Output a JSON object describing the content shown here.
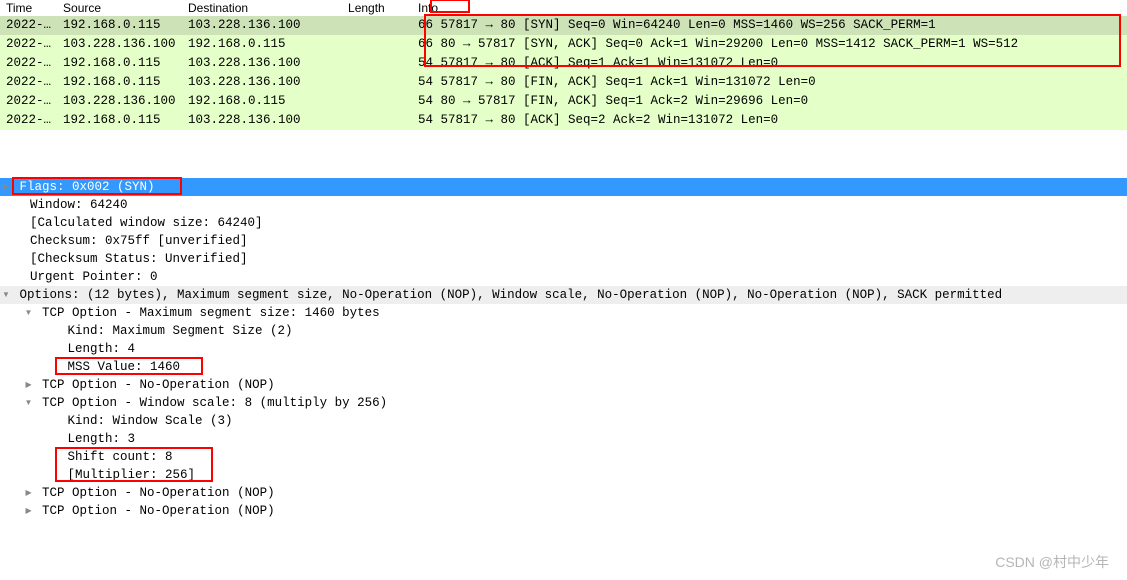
{
  "columns": {
    "time": "Time",
    "source": "Source",
    "destination": "Destination",
    "length": "Length",
    "info": "Info"
  },
  "packets": [
    {
      "time": "2022-…",
      "src": "192.168.0.115",
      "dst": "103.228.136.100",
      "len": "",
      "info": "66 57817 → 80 [SYN] Seq=0 Win=64240 Len=0 MSS=1460 WS=256 SACK_PERM=1",
      "cls": "row-sel"
    },
    {
      "time": "2022-…",
      "src": "103.228.136.100",
      "dst": "192.168.0.115",
      "len": "",
      "info": "66 80 → 57817 [SYN, ACK] Seq=0 Ack=1 Win=29200 Len=0 MSS=1412 SACK_PERM=1 WS=512",
      "cls": "row-light"
    },
    {
      "time": "2022-…",
      "src": "192.168.0.115",
      "dst": "103.228.136.100",
      "len": "",
      "info": "54 57817 → 80 [ACK] Seq=1 Ack=1 Win=131072 Len=0",
      "cls": "row-light"
    },
    {
      "time": "2022-…",
      "src": "192.168.0.115",
      "dst": "103.228.136.100",
      "len": "",
      "info": "54 57817 → 80 [FIN, ACK] Seq=1 Ack=1 Win=131072 Len=0",
      "cls": "row-light"
    },
    {
      "time": "2022-…",
      "src": "103.228.136.100",
      "dst": "192.168.0.115",
      "len": "",
      "info": "54 80 → 57817 [FIN, ACK] Seq=1 Ack=2 Win=29696 Len=0",
      "cls": "row-light"
    },
    {
      "time": "2022-…",
      "src": "192.168.0.115",
      "dst": "103.228.136.100",
      "len": "",
      "info": "54 57817 → 80 [ACK] Seq=2 Ack=2 Win=131072 Len=0",
      "cls": "row-light"
    }
  ],
  "detail": {
    "flags": "Flags: 0x002 (SYN)",
    "window": "Window: 64240",
    "calcwin": "[Calculated window size: 64240]",
    "checksum": "Checksum: 0x75ff [unverified]",
    "checksum_status": "[Checksum Status: Unverified]",
    "urgent": "Urgent Pointer: 0",
    "options_header": "Options: (12 bytes), Maximum segment size, No-Operation (NOP), Window scale, No-Operation (NOP), No-Operation (NOP), SACK permitted",
    "mss_header": "TCP Option - Maximum segment size: 1460 bytes",
    "mss_kind": "Kind: Maximum Segment Size (2)",
    "mss_len": "Length: 4",
    "mss_val": "MSS Value: 1460",
    "nop1": "TCP Option - No-Operation (NOP)",
    "ws_header": "TCP Option - Window scale: 8 (multiply by 256)",
    "ws_kind": "Kind: Window Scale (3)",
    "ws_len": "Length: 3",
    "ws_shift": "Shift count: 8",
    "ws_mult": "[Multiplier: 256]",
    "nop2": "TCP Option - No-Operation (NOP)",
    "nop3": "TCP Option - No-Operation (NOP)"
  },
  "watermark": "CSDN @村中少年"
}
